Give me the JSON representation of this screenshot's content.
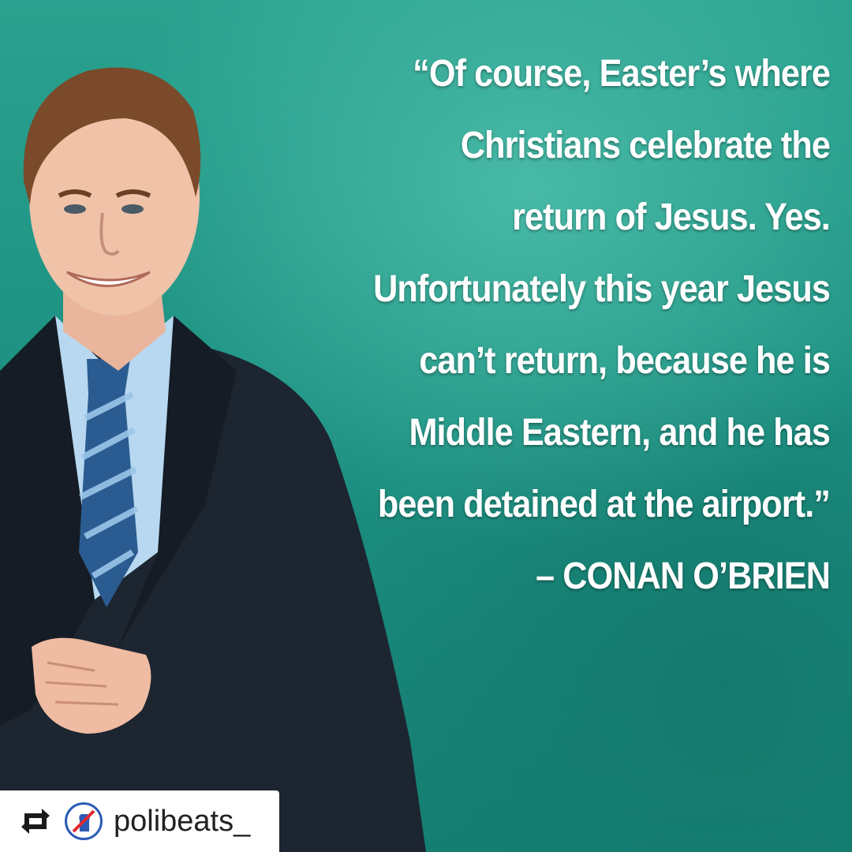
{
  "quote": {
    "lines": [
      "“Of course, Easter’s where",
      "Christians celebrate the",
      "return of Jesus. Yes.",
      "Unfortunately this year Jesus",
      "can’t return, because he is",
      "Middle Eastern, and he has",
      "been detained at the airport.”",
      "– CONAN O’BRIEN"
    ]
  },
  "repost": {
    "username": "polibeats_",
    "icon": "repost-icon",
    "avatar_icon": "raised-fist-icon"
  },
  "colors": {
    "background": "#1a8f80",
    "text": "#ffffff",
    "avatar_ring": "#2b5bb5",
    "avatar_accent": "#e0282e"
  }
}
